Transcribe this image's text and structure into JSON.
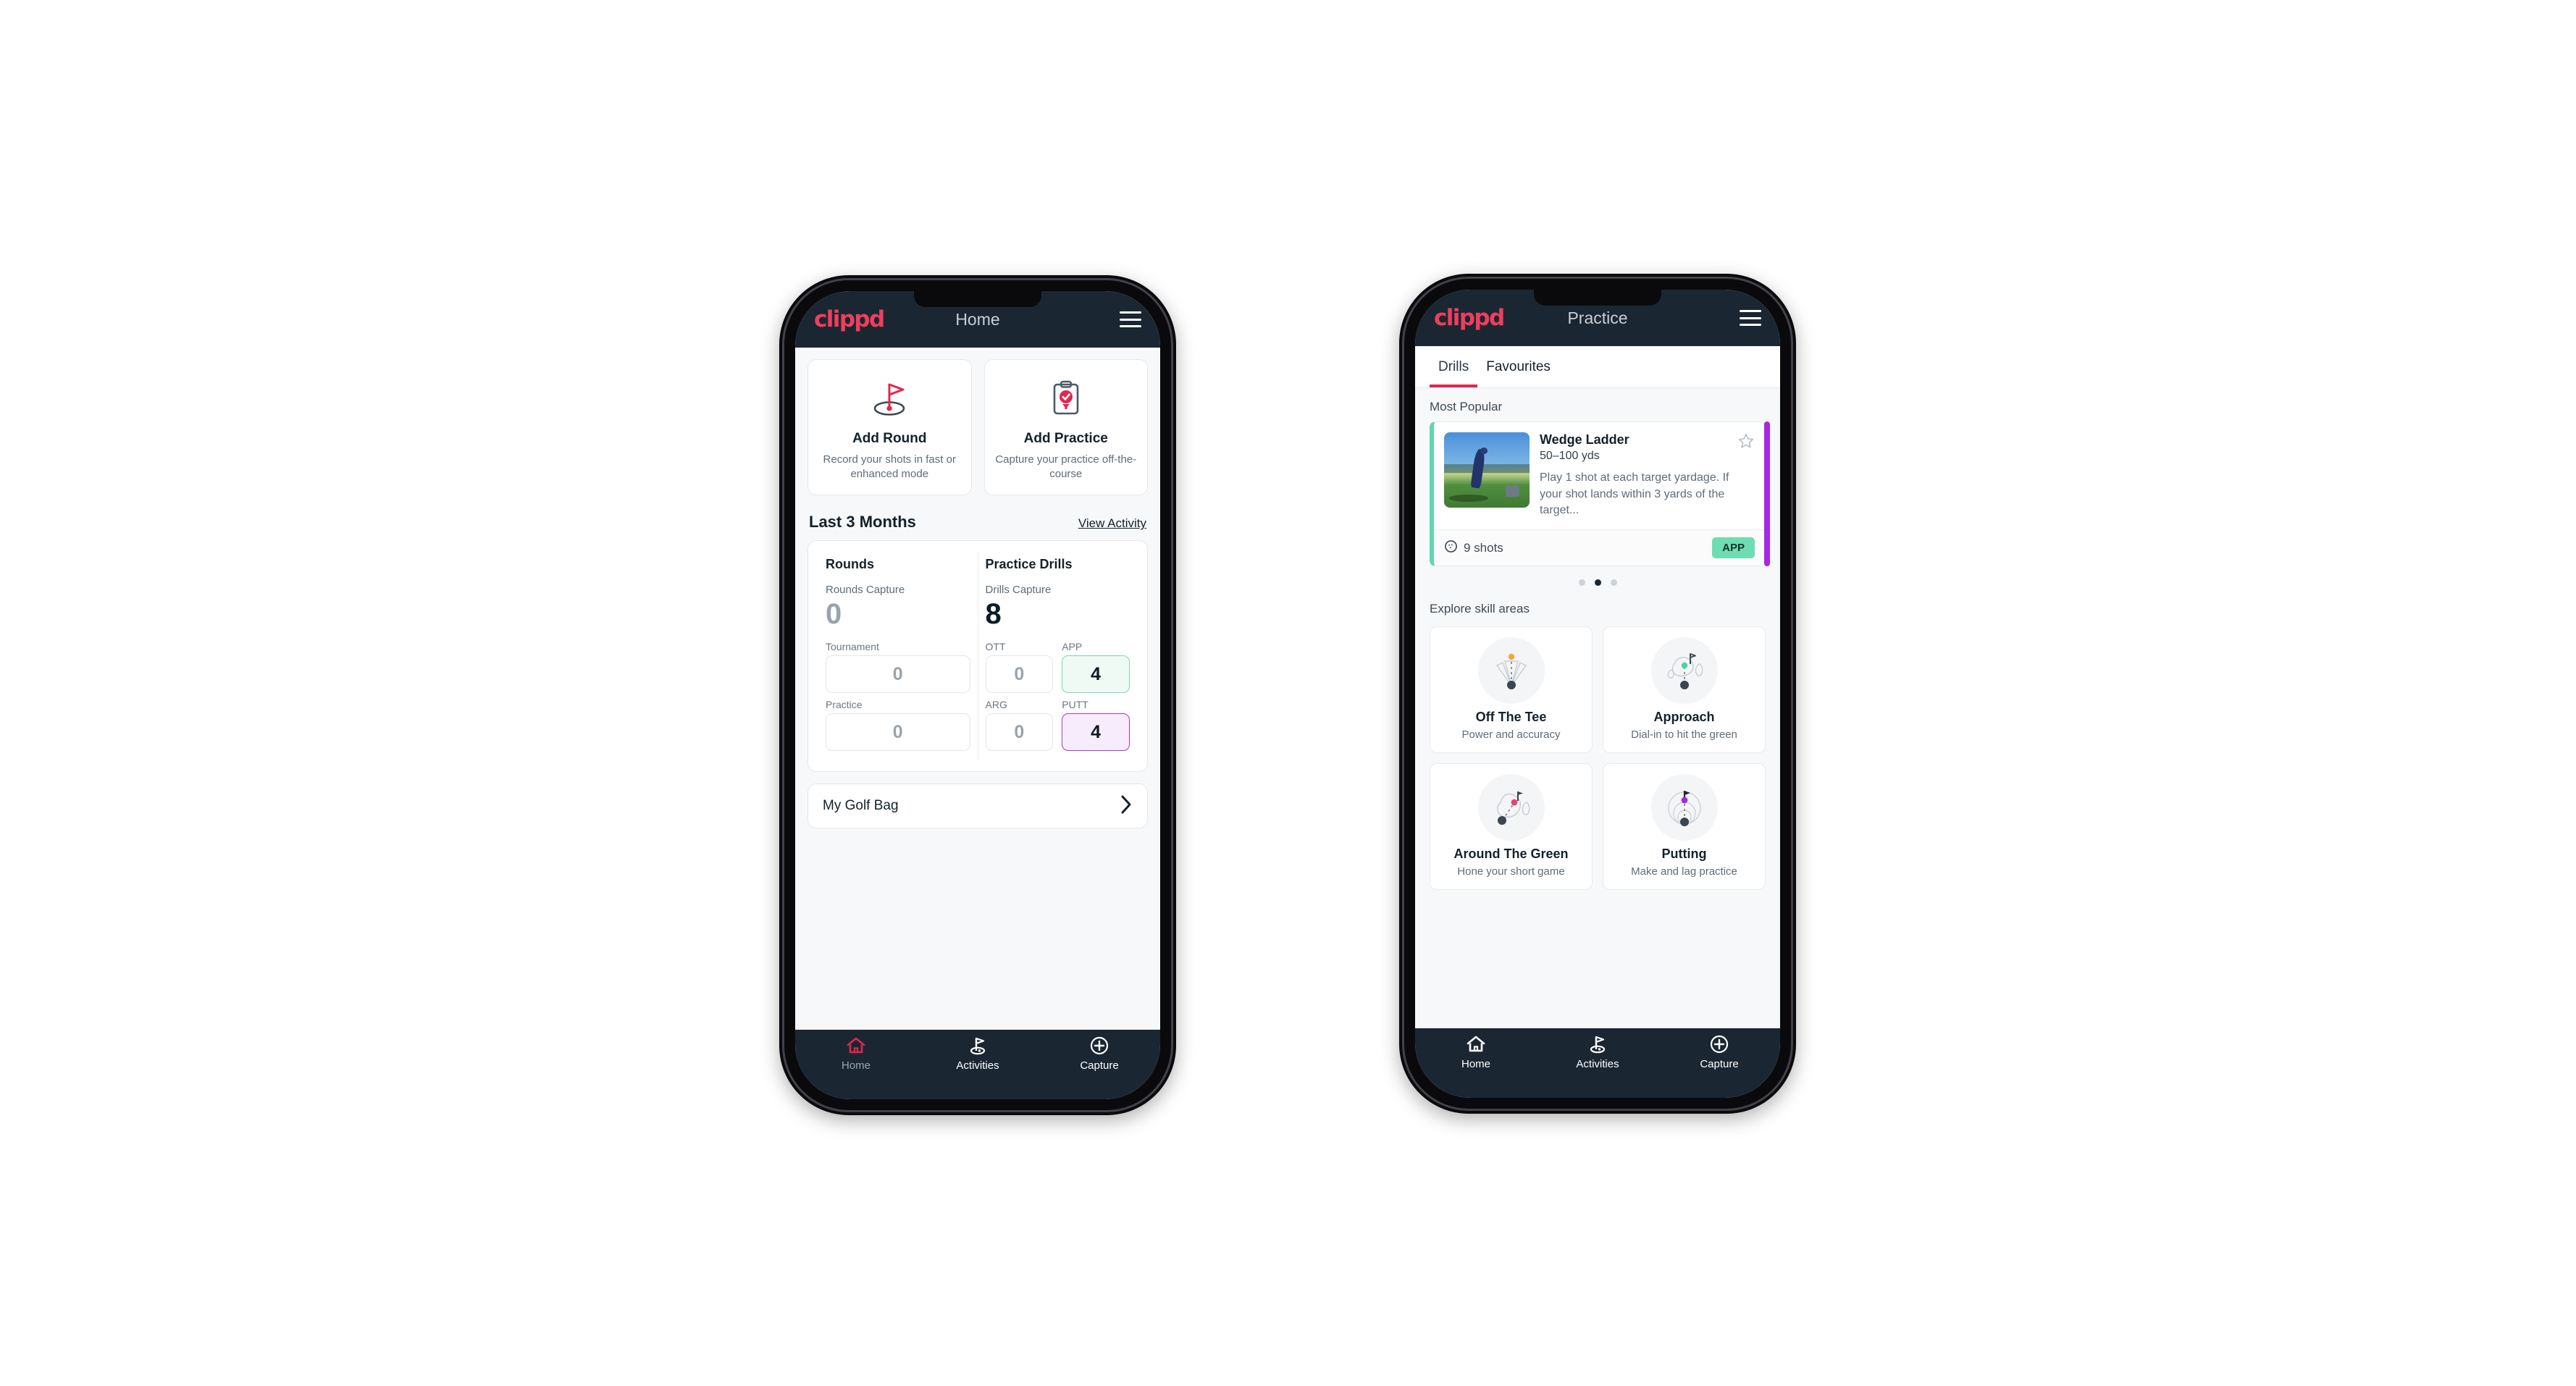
{
  "phone1": {
    "header": {
      "logo": "clippd",
      "title": "Home",
      "menu_icon": "hamburger-icon"
    },
    "quick_actions": [
      {
        "icon": "golf-flag-hole-icon",
        "title": "Add Round",
        "subtitle": "Record your shots in fast or enhanced mode"
      },
      {
        "icon": "clipboard-check-tee-icon",
        "title": "Add Practice",
        "subtitle": "Capture your practice off-the-course"
      }
    ],
    "section": {
      "title": "Last 3 Months",
      "link": "View Activity"
    },
    "rounds": {
      "col_title": "Rounds",
      "capture_label": "Rounds Capture",
      "capture_value": "0",
      "items": [
        {
          "label": "Tournament",
          "value": "0",
          "state": "default"
        },
        {
          "label": "Practice",
          "value": "0",
          "state": "default"
        }
      ]
    },
    "drills": {
      "col_title": "Practice Drills",
      "capture_label": "Drills Capture",
      "capture_value": "8",
      "items": [
        {
          "label": "OTT",
          "value": "0",
          "state": "default"
        },
        {
          "label": "APP",
          "value": "4",
          "state": "app"
        },
        {
          "label": "ARG",
          "value": "0",
          "state": "default"
        },
        {
          "label": "PUTT",
          "value": "4",
          "state": "putt"
        }
      ]
    },
    "golf_bag": {
      "label": "My Golf Bag",
      "chevron": "chevron-right-icon"
    },
    "bottom_nav": [
      {
        "label": "Home",
        "icon": "home-icon",
        "selected": true
      },
      {
        "label": "Activities",
        "icon": "golf-flag-icon",
        "selected": false
      },
      {
        "label": "Capture",
        "icon": "plus-circle-icon",
        "selected": false
      }
    ]
  },
  "phone2": {
    "header": {
      "logo": "clippd",
      "title": "Practice",
      "menu_icon": "hamburger-icon"
    },
    "tabs": [
      {
        "label": "Drills",
        "selected": true
      },
      {
        "label": "Favourites",
        "selected": false
      }
    ],
    "most_popular_label": "Most Popular",
    "drill": {
      "title": "Wedge Ladder",
      "yardage": "50–100 yds",
      "description": "Play 1 shot at each target yardage. If your shot lands within 3 yards of the target...",
      "shots": "9 shots",
      "shots_icon": "golf-ball-icon",
      "badge": "APP",
      "favourite_icon": "star-outline-icon",
      "accent_color": "#5fd7ae",
      "next_accent_color": "#a728e0"
    },
    "carousel_dots": {
      "count": 3,
      "active_index": 1
    },
    "explore_label": "Explore skill areas",
    "skill_areas": [
      {
        "icon": "tee-dispersion-icon",
        "title": "Off The Tee",
        "subtitle": "Power and accuracy",
        "dot_color": "#f3a93c"
      },
      {
        "icon": "green-approach-icon",
        "title": "Approach",
        "subtitle": "Dial-in to hit the green",
        "dot_color": "#4fd1a5"
      },
      {
        "icon": "chip-around-green-icon",
        "title": "Around The Green",
        "subtitle": "Hone your short game",
        "dot_color": "#e8436a"
      },
      {
        "icon": "putting-rings-icon",
        "title": "Putting",
        "subtitle": "Make and lag practice",
        "dot_color": "#a728e0"
      }
    ],
    "bottom_nav": [
      {
        "label": "Home",
        "icon": "home-icon",
        "selected": false
      },
      {
        "label": "Activities",
        "icon": "golf-flag-icon",
        "selected": false
      },
      {
        "label": "Capture",
        "icon": "plus-circle-icon",
        "selected": false
      }
    ]
  },
  "colors": {
    "brand_pink": "#ef3e5c",
    "header_navy": "#1a2733",
    "tab_underline": "#e2264d",
    "app_accent": "#7ed6b4",
    "putt_accent": "#a637d6"
  }
}
